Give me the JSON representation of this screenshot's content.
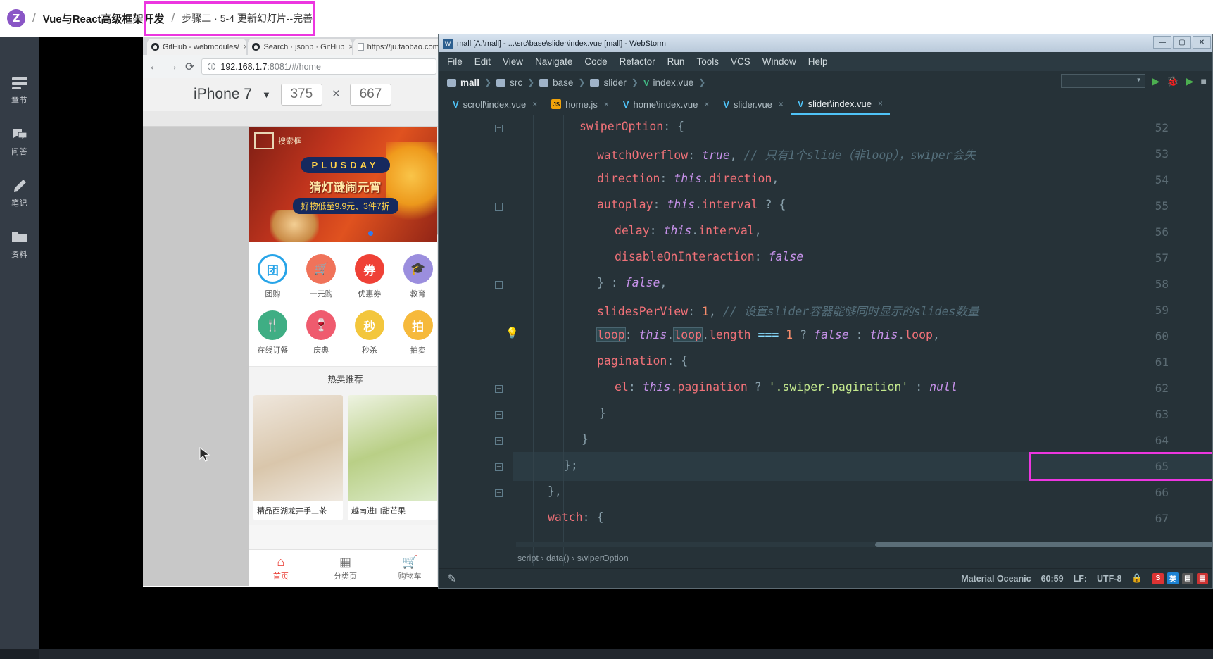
{
  "breadcrumb": {
    "logo": "Z",
    "sep": "/",
    "course": "Vue与React高级框架开发",
    "lesson": "步骤二 · 5-4 更新幻灯片--完善"
  },
  "rail": {
    "items": [
      {
        "icon": "chapters-icon",
        "label": "章节"
      },
      {
        "icon": "qa-icon",
        "label": "问答"
      },
      {
        "icon": "notes-icon",
        "label": "笔记"
      },
      {
        "icon": "materials-icon",
        "label": "资料"
      }
    ]
  },
  "browser": {
    "tabs": [
      {
        "title": "GitHub - webmodules/",
        "icon": "github-icon",
        "close": "×"
      },
      {
        "title": "Search · jsonp · GitHub",
        "icon": "github-icon",
        "close": "×"
      },
      {
        "title": "https://ju.taobao.com/",
        "icon": "page-icon",
        "close": "×"
      }
    ],
    "nav": {
      "back": "←",
      "forward": "→",
      "reload": "⟳"
    },
    "omnibox": {
      "info": "i",
      "host": "192.168.1.7",
      "rest": ":8081/#/home"
    },
    "device": {
      "name": "iPhone 7",
      "caret": "▼",
      "width": "375",
      "times": "×",
      "height": "667"
    }
  },
  "phone": {
    "banner": {
      "search_placeholder": "搜索框",
      "plus_day": "PLUSDAY",
      "headline": "猜灯谜闹元宵",
      "subline": "好物低至9.9元、3件7折"
    },
    "grid": [
      {
        "label": "团购",
        "glyph": "团",
        "color": "#27a4e8",
        "style": "ring"
      },
      {
        "label": "一元购",
        "glyph": "🛒",
        "color": "#f0735a",
        "style": "solid"
      },
      {
        "label": "优惠券",
        "glyph": "券",
        "color": "#ef4136",
        "style": "solid"
      },
      {
        "label": "教育",
        "glyph": "🎓",
        "color": "#9b8ede",
        "style": "solid"
      },
      {
        "label": "在线订餐",
        "glyph": "🍴",
        "color": "#3fae84",
        "style": "solid"
      },
      {
        "label": "庆典",
        "glyph": "🍷",
        "color": "#ef5b6e",
        "style": "solid"
      },
      {
        "label": "秒杀",
        "glyph": "秒",
        "color": "#f3c63c",
        "style": "solid"
      },
      {
        "label": "拍卖",
        "glyph": "拍",
        "color": "#f6b93b",
        "style": "solid"
      }
    ],
    "section_title": "热卖推荐",
    "cards": [
      {
        "name": "精品西湖龙井手工茶"
      },
      {
        "name": "越南进口甜芒果"
      }
    ],
    "tabbar": [
      {
        "icon": "home-icon",
        "glyph": "⌂",
        "label": "首页",
        "active": true
      },
      {
        "icon": "category-icon",
        "glyph": "▦",
        "label": "分类页",
        "active": false
      },
      {
        "icon": "cart-icon",
        "glyph": "🛒",
        "label": "购物车",
        "active": false
      }
    ]
  },
  "ide": {
    "title": "mall [A:\\mall] - ...\\src\\base\\slider\\index.vue [mall] - WebStorm",
    "title_icon": "W",
    "window_buttons": [
      "—",
      "▢",
      "✕"
    ],
    "menu": [
      "File",
      "Edit",
      "View",
      "Navigate",
      "Code",
      "Refactor",
      "Run",
      "Tools",
      "VCS",
      "Window",
      "Help"
    ],
    "breadcrumbs": [
      {
        "label": "mall",
        "icon": "folder-icon",
        "bold": true
      },
      {
        "label": "src",
        "icon": "folder-icon",
        "bold": false
      },
      {
        "label": "base",
        "icon": "folder-icon",
        "bold": false
      },
      {
        "label": "slider",
        "icon": "folder-icon",
        "bold": false
      },
      {
        "label": "index.vue",
        "icon": "vue-icon",
        "bold": false
      }
    ],
    "editor_tabs": [
      {
        "label": "scroll\\index.vue",
        "icon": "vue-icon",
        "selected": false
      },
      {
        "label": "home.js",
        "icon": "js-icon",
        "selected": false
      },
      {
        "label": "home\\index.vue",
        "icon": "vue-icon",
        "selected": false
      },
      {
        "label": "slider.vue",
        "icon": "vue-icon",
        "selected": false
      },
      {
        "label": "slider\\index.vue",
        "icon": "vue-icon",
        "selected": true
      }
    ],
    "code": {
      "first_line": 52,
      "last_line": 67,
      "highlighted_line": 60,
      "lines": [
        {
          "n": 52,
          "text": "swiperOption: {"
        },
        {
          "n": 53,
          "text": "  watchOverflow: true, // 只有1个slide（非loop），swiper会失"
        },
        {
          "n": 54,
          "text": "  direction: this.direction,"
        },
        {
          "n": 55,
          "text": "  autoplay: this.interval ? {"
        },
        {
          "n": 56,
          "text": "    delay: this.interval,"
        },
        {
          "n": 57,
          "text": "    disableOnInteraction: false"
        },
        {
          "n": 58,
          "text": "  } : false,"
        },
        {
          "n": 59,
          "text": "  slidesPerView: 1, // 设置slider容器能够同时显示的slides数量"
        },
        {
          "n": 60,
          "text": "  loop: this.loop.length === 1 ? false : this.loop,"
        },
        {
          "n": 61,
          "text": "  pagination: {"
        },
        {
          "n": 62,
          "text": "    el: this.pagination ? '.swiper-pagination' : null"
        },
        {
          "n": 63,
          "text": "  }"
        },
        {
          "n": 64,
          "text": "}"
        },
        {
          "n": 65,
          "text": "};"
        },
        {
          "n": 66,
          "text": "},"
        },
        {
          "n": 67,
          "text": "watch: {"
        }
      ]
    },
    "nav_path": "script › data() › swiperOption",
    "status": {
      "theme": "Material Oceanic",
      "caret": "60:59",
      "line_sep": "LF:",
      "encoding": "UTF-8",
      "ime": "英",
      "lock_icon": "lock-icon"
    }
  }
}
